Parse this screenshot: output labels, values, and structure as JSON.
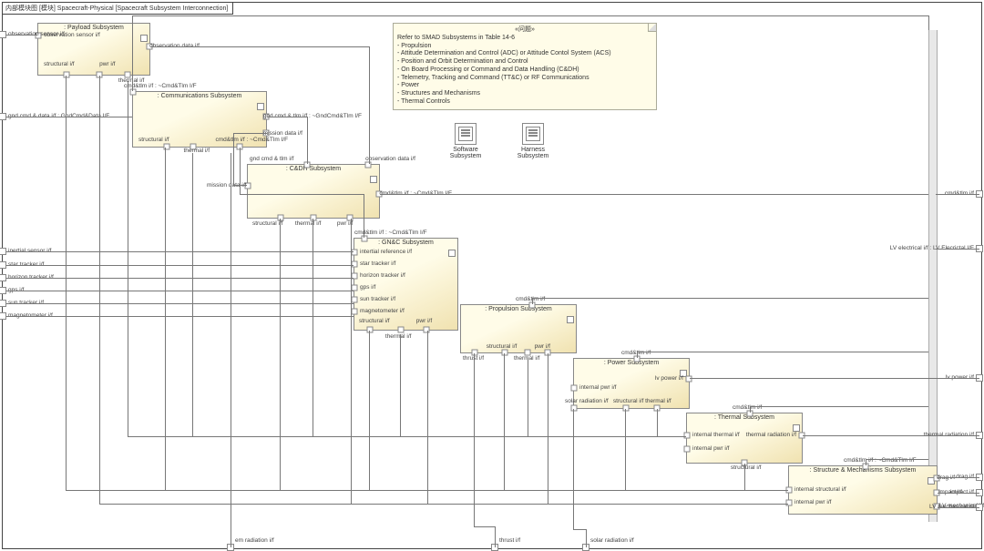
{
  "frame": {
    "title": "内部模块图 [模块] Spacecraft-Physical [Spacecraft Subsystem Interconnection]"
  },
  "note": {
    "stereo": "«问题»",
    "l1": "Refer to SMAD Subsystems in Table 14-6",
    "l2": "- Propulsion",
    "l3": "- Attitude Determination and Control (ADC) or Attitude Contol System (ACS)",
    "l4": "- Position and Orbit Determination and Control",
    "l5": "- On Board Processing or Command and Data Handling (C&DH)",
    "l6": "- Telemetry, Tracking and Command (TT&C) or RF Communications",
    "l7": "- Power",
    "l8": "- Structures and Mechanisms",
    "l9": "- Thermal Controls"
  },
  "icons": {
    "sw": "Software Subsystem",
    "hw": "Harness Subsystem"
  },
  "blocks": {
    "payload": {
      "title": ": Payload Subsystem",
      "ports": {
        "obs_sensor": "observation sensor i/f",
        "obs_data": "observation data i/f",
        "structural": "structural i/f",
        "pwr": "pwr i/f",
        "thermal": "thermal i/f"
      }
    },
    "comm": {
      "title": ": Communications Subsystem",
      "flow": "cmd&tlm i/f : ~Cmd&Tlm I/F",
      "ports": {
        "gnd_cmd_tlm": "gnd cmd & tlm i/f : ~GndCmd&Tlm I/F",
        "mission_data": "mission data i/f",
        "structural": "structural i/f",
        "thermal": "thermal i/f",
        "cmd_tlm": "cmd&tlm i/f : ~Cmd&Tlm I/F"
      }
    },
    "cdh": {
      "title": ": C&DH Subsystem",
      "ports": {
        "gnd_cmd_tlm": "gnd cmd & tlm i/f",
        "obs_data": "observation data i/f",
        "mission_data": "mission data i/f",
        "cmd_tlm": "cmd&tlm i/f : ~Cmd&Tlm I/F",
        "structural": "structural i/f",
        "thermal": "thermal i/f",
        "pwr": "pwr i/f"
      }
    },
    "gnc": {
      "title": ": GN&C Subsystem",
      "flow": "cmd&tlm i/f : ~Cmd&Tlm I/F",
      "ports": {
        "inertial": "intertial reference i/f",
        "star": "star tracker i/f",
        "horizon": "horizon tracker i/f",
        "gps": "gps i/f",
        "sun": "sun tracker i/f",
        "magnet": "magnetometer i/f",
        "structural": "structural i/f",
        "pwr": "pwr i/f",
        "thermal": "thermal i/f"
      }
    },
    "propulsion": {
      "title": ": Propulsion Subsystem",
      "flow": "cmd&tlm i/f",
      "ports": {
        "thrust": "thrust i/f",
        "structural": "structural i/f",
        "pwr": "pwr i/f",
        "thermal": "thermal i/f"
      }
    },
    "power": {
      "title": ": Power Subsystem",
      "flow": "cmd&tlm i/f",
      "ports": {
        "lv_power": "lv power i/f",
        "internal_pwr": "internal pwr i/f",
        "solar": "solar radiation i/f",
        "structural": "structural i/f",
        "thermal": "thermal i/f"
      }
    },
    "thermal": {
      "title": ": Thermal Subsystem",
      "flow": "cmd&tlm i/f",
      "ports": {
        "internal_thermal": "internal thermal i/f",
        "internal_pwr": "internal pwr i/f",
        "thermal_rad": "thermal radiation i/f",
        "structural": "structural i/f"
      }
    },
    "structure": {
      "title": ": Structure & Mechanisms Subsystem",
      "flow": "cmd&tlm i/f : ~Cmd&Tlm I/F",
      "ports": {
        "internal_struct": "internal structural i/f",
        "internal_pwr": "internal pwr i/f",
        "lv_mech": "LV mechanical i/f",
        "drag": "drag i/f",
        "impact": "impact i/f"
      }
    }
  },
  "boundary": {
    "left": {
      "obs_sensor": "observation sensor i/f",
      "gnd_cmd_data": "gnd cmd & data i/f : GndCmd&Data I/F",
      "inertial": "inertial sensor i/f",
      "star": "star tracker i/f",
      "horizon": "horizon tracker i/f",
      "gps": "gps i/f",
      "sun": "sun tracker i/f",
      "magnet": "magnetometer i/f"
    },
    "right": {
      "cmd_tlm": "cmd&tlm i/f",
      "lv_elec": "LV electrical i/f : LV Elecrictal I/F",
      "lv_power": "lv power i/f",
      "thermal_rad": "thermal radiation i/f",
      "drag": "drag i/f",
      "impact": "impact i/f",
      "lv_mech": "LV mechanical i/f"
    },
    "bottom": {
      "em_rad": "em radiation i/f",
      "thrust": "thrust i/f",
      "solar": "solar radiation i/f"
    }
  }
}
